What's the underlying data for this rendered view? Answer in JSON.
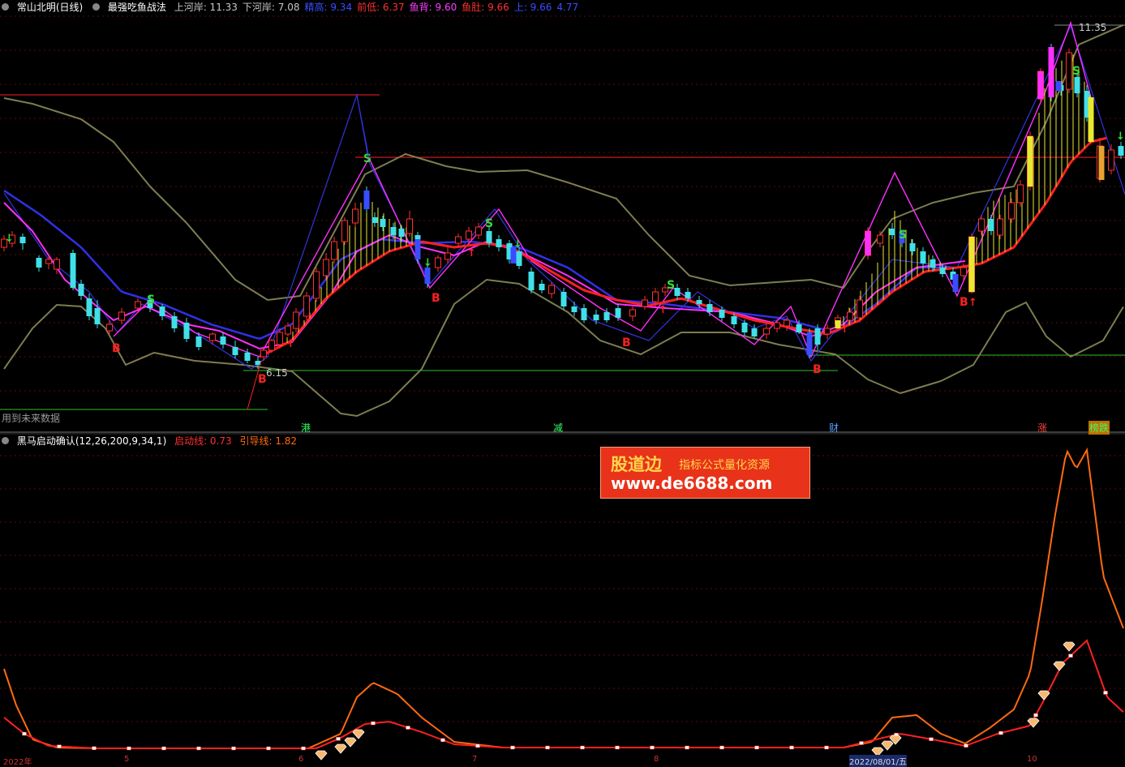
{
  "header": {
    "stock": "常山北明(日线)",
    "indicator": "最强吃鱼战法",
    "items": [
      {
        "label": "上河岸: 11.33",
        "color": "#c8c8c8"
      },
      {
        "label": "下河岸: 7.08",
        "color": "#c8c8c8"
      },
      {
        "label": "精高: 9.34",
        "color": "#3a4cff"
      },
      {
        "label": "前低: 6.37",
        "color": "#ff3030"
      },
      {
        "label": "鱼背: 9.60",
        "color": "#ff3cff"
      },
      {
        "label": "鱼肚: 9.66",
        "color": "#ff3030"
      },
      {
        "label": "上: 9.66",
        "color": "#3a4cff"
      },
      {
        "label": "4.77",
        "color": "#3a4cff"
      }
    ]
  },
  "sub_header": {
    "indicator": "黑马启动确认(12,26,200,9,34,1)",
    "line1_label": "启动线: 0.73",
    "line2_label": "引导线: 1.82"
  },
  "annotations": {
    "high_price": "11.35",
    "low_price": "6.15",
    "future_data_note": "用到未来数据",
    "buy": "B",
    "sell": "S"
  },
  "events": [
    {
      "label": "港",
      "bg": "#1a1a1a",
      "color": "#33ff66"
    },
    {
      "label": "减",
      "bg": "#1a1a1a",
      "color": "#33ff66"
    },
    {
      "label": "财",
      "bg": "#1a1a1a",
      "color": "#5aa0ff"
    },
    {
      "label": "涨",
      "bg": "#1a1a1a",
      "color": "#ff4040"
    },
    {
      "label": "榜跌",
      "bg": "#c07000",
      "color": "#33ff66"
    }
  ],
  "ad": {
    "brand": "股道边",
    "slogan": "指标公式量化资源",
    "url": "www.de6688.com"
  },
  "date_labels": [
    "2022年",
    "5",
    "6",
    "7",
    "8",
    "2022/08/01/五",
    "10"
  ],
  "colors": {
    "up": "#ff3030",
    "down": "#40e0e8",
    "magenta": "#ff30ff",
    "blue": "#3030e8",
    "band": "#8a8a5a",
    "orange": "#ff6a10"
  }
}
